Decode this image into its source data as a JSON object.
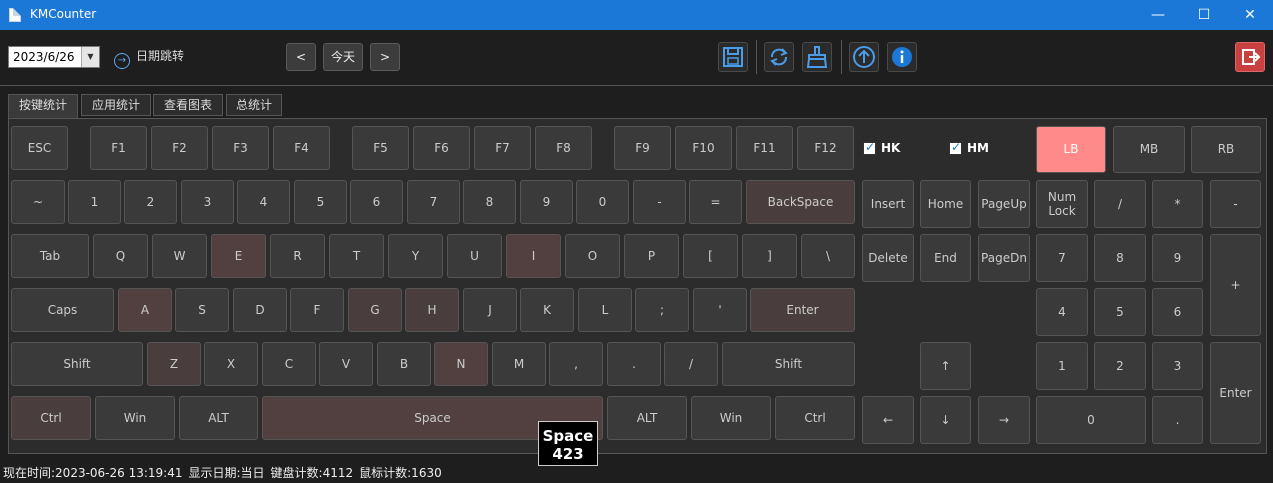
{
  "window": {
    "title": "KMCounter",
    "minimize": "—",
    "maximize": "☐",
    "close": "✕"
  },
  "toolbar": {
    "date_value": "2023/6/26",
    "date_dropdown": "▼",
    "jump_label": "日期跳转",
    "prev_label": "<",
    "today_label": "今天",
    "next_label": ">",
    "icons": [
      "save-icon",
      "refresh-icon",
      "clear-icon",
      "update-icon",
      "info-icon",
      "exit-icon"
    ],
    "accent_color": "#1b78d7"
  },
  "tabs": [
    "按键统计",
    "应用统计",
    "查看图表",
    "总统计"
  ],
  "active_tab": 0,
  "keyboard": {
    "row_fn": [
      "ESC",
      "F1",
      "F2",
      "F3",
      "F4",
      "F5",
      "F6",
      "F7",
      "F8",
      "F9",
      "F10",
      "F11",
      "F12"
    ],
    "row_num": [
      "~",
      "1",
      "2",
      "3",
      "4",
      "5",
      "6",
      "7",
      "8",
      "9",
      "0",
      "-",
      "=",
      "BackSpace"
    ],
    "row_tab": [
      "Tab",
      "Q",
      "W",
      "E",
      "R",
      "T",
      "Y",
      "U",
      "I",
      "O",
      "P",
      "[",
      "]",
      "\\"
    ],
    "row_caps": [
      "Caps",
      "A",
      "S",
      "D",
      "F",
      "G",
      "H",
      "J",
      "K",
      "L",
      ";",
      "'",
      "Enter"
    ],
    "row_shift": [
      "Shift",
      "Z",
      "X",
      "C",
      "V",
      "B",
      "N",
      "M",
      ",",
      ".",
      "/",
      "Shift"
    ],
    "row_ctrl": [
      "Ctrl",
      "Win",
      "ALT",
      "Space",
      "ALT",
      "Win",
      "Ctrl"
    ],
    "nav_top": [
      "Insert",
      "Home",
      "PageUp"
    ],
    "nav_bottom": [
      "Delete",
      "End",
      "PageDn"
    ],
    "arrows": [
      "↑",
      "←",
      "↓",
      "→"
    ],
    "numpad": {
      "row1": [
        "Num\nLock",
        "/",
        "*",
        "-"
      ],
      "row2": [
        "7",
        "8",
        "9"
      ],
      "plus": "+",
      "row3": [
        "4",
        "5",
        "6"
      ],
      "row4": [
        "1",
        "2",
        "3"
      ],
      "enter": "Enter",
      "zero": "0",
      "dot": "."
    },
    "mouse": [
      "LB",
      "MB",
      "RB"
    ],
    "checkboxes": [
      "HK",
      "HM"
    ]
  },
  "tooltip": {
    "key": "Space",
    "count": "423"
  },
  "status": {
    "now": "现在时间:2023-06-26 13:19:41",
    "display": "显示日期:当日",
    "keyboard_count": "键盘计数:4112",
    "mouse_count": "鼠标计数:1630"
  }
}
